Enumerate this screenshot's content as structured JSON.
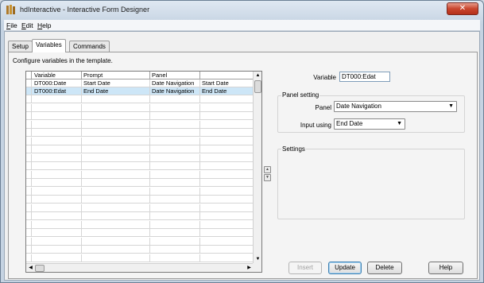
{
  "window": {
    "title": "hdInteractive - Interactive Form Designer",
    "close_glyph": "✕"
  },
  "menu": [
    {
      "mnemonic": "F",
      "rest": "ile"
    },
    {
      "mnemonic": "E",
      "rest": "dit"
    },
    {
      "mnemonic": "H",
      "rest": "elp"
    }
  ],
  "tabs": [
    "Setup",
    "Variables",
    "Commands"
  ],
  "active_tab": "Variables",
  "panel": {
    "instruction": "Configure variables in the template."
  },
  "grid": {
    "columns": [
      "Variable",
      "Prompt",
      "Panel",
      ""
    ],
    "rows": [
      [
        "DT000:Date",
        "Start Date",
        "Date Navigation",
        "Start Date"
      ],
      [
        "DT000:Edat",
        "End Date",
        "Date Navigation",
        "End Date"
      ]
    ],
    "selected_row": 1,
    "arrow_up": "▲",
    "arrow_down": "▼",
    "arrow_left": "◀",
    "arrow_right": "▶"
  },
  "form": {
    "variable_label": "Variable",
    "variable_value": "DT000:Edat",
    "panel_setting_label": "Panel setting",
    "panel_label": "Panel",
    "panel_value": "Date Navigation",
    "input_using_label": "Input using",
    "input_using_value": "End Date",
    "settings_label": "Settings",
    "dropdown_glyph": "▼"
  },
  "buttons": {
    "insert": "Insert",
    "update": "Update",
    "delete": "Delete",
    "help": "Help"
  },
  "colors": {
    "selection": "#cde6f7",
    "close_button": "#c9452d"
  }
}
